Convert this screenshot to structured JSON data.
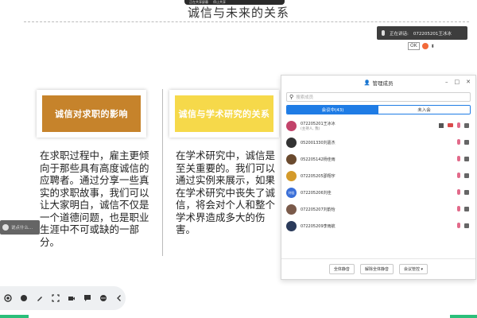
{
  "top_bar": {
    "left_text": "正在共享屏幕",
    "right_text": "停止共享"
  },
  "slide": {
    "title": "诚信与未来的关系",
    "card1_heading": "诚信对求职的影响",
    "card2_heading": "诚信与学术研究的关系",
    "card1_body": "在求职过程中，雇主更倾向于那些具有高度诚信的应聘者。通过分享一些真实的求职故事，我们可以让大家明白，诚信不仅是一个道德问题，也是职业生涯中不可或缺的一部分。",
    "card2_body": "在学术研究中，诚信是至关重要的。我们可以通过实例来展示，如果在学术研究中丧失了诚信，将会对个人和整个学术界造成多大的伤害。"
  },
  "speaker_banner": {
    "label": "正在讲话:",
    "name": "072205201王冰冰"
  },
  "ok_control": {
    "label": "OK"
  },
  "floating_note": {
    "text": "说点什么..."
  },
  "members_panel": {
    "title": "管理成员",
    "search_placeholder": "搜索成员",
    "tabs": [
      {
        "label": "会议中(43)"
      },
      {
        "label": "未入会"
      }
    ],
    "members": [
      {
        "name": "072205201王冰冰",
        "sub": "(主持人, 我)",
        "avatar_color": "#c2436a"
      },
      {
        "name": "052001330刘嘉杰",
        "sub": "",
        "avatar_color": "#333333"
      },
      {
        "name": "052205142杨佳雨",
        "sub": "",
        "avatar_color": "#6a4a2e"
      },
      {
        "name": "072205205邵翔宇",
        "sub": "",
        "avatar_color": "#d49a2a"
      },
      {
        "name": "072205206刘佳",
        "sub": "",
        "avatar_color": "#3a6fd8",
        "avatar_text": "刘佳"
      },
      {
        "name": "072205207刘韵怡",
        "sub": "",
        "avatar_color": "#7a5a4a"
      },
      {
        "name": "072205209李雨航",
        "sub": "",
        "avatar_color": "#2a3a5a"
      }
    ],
    "footer_buttons": {
      "mute_all": "全体静音",
      "unmute_all": "解除全体静音",
      "manage": "会议管控 ▾"
    }
  },
  "colors": {
    "card1": "#c6832b",
    "card2": "#f6d94a",
    "accent": "#1f7ce5"
  }
}
